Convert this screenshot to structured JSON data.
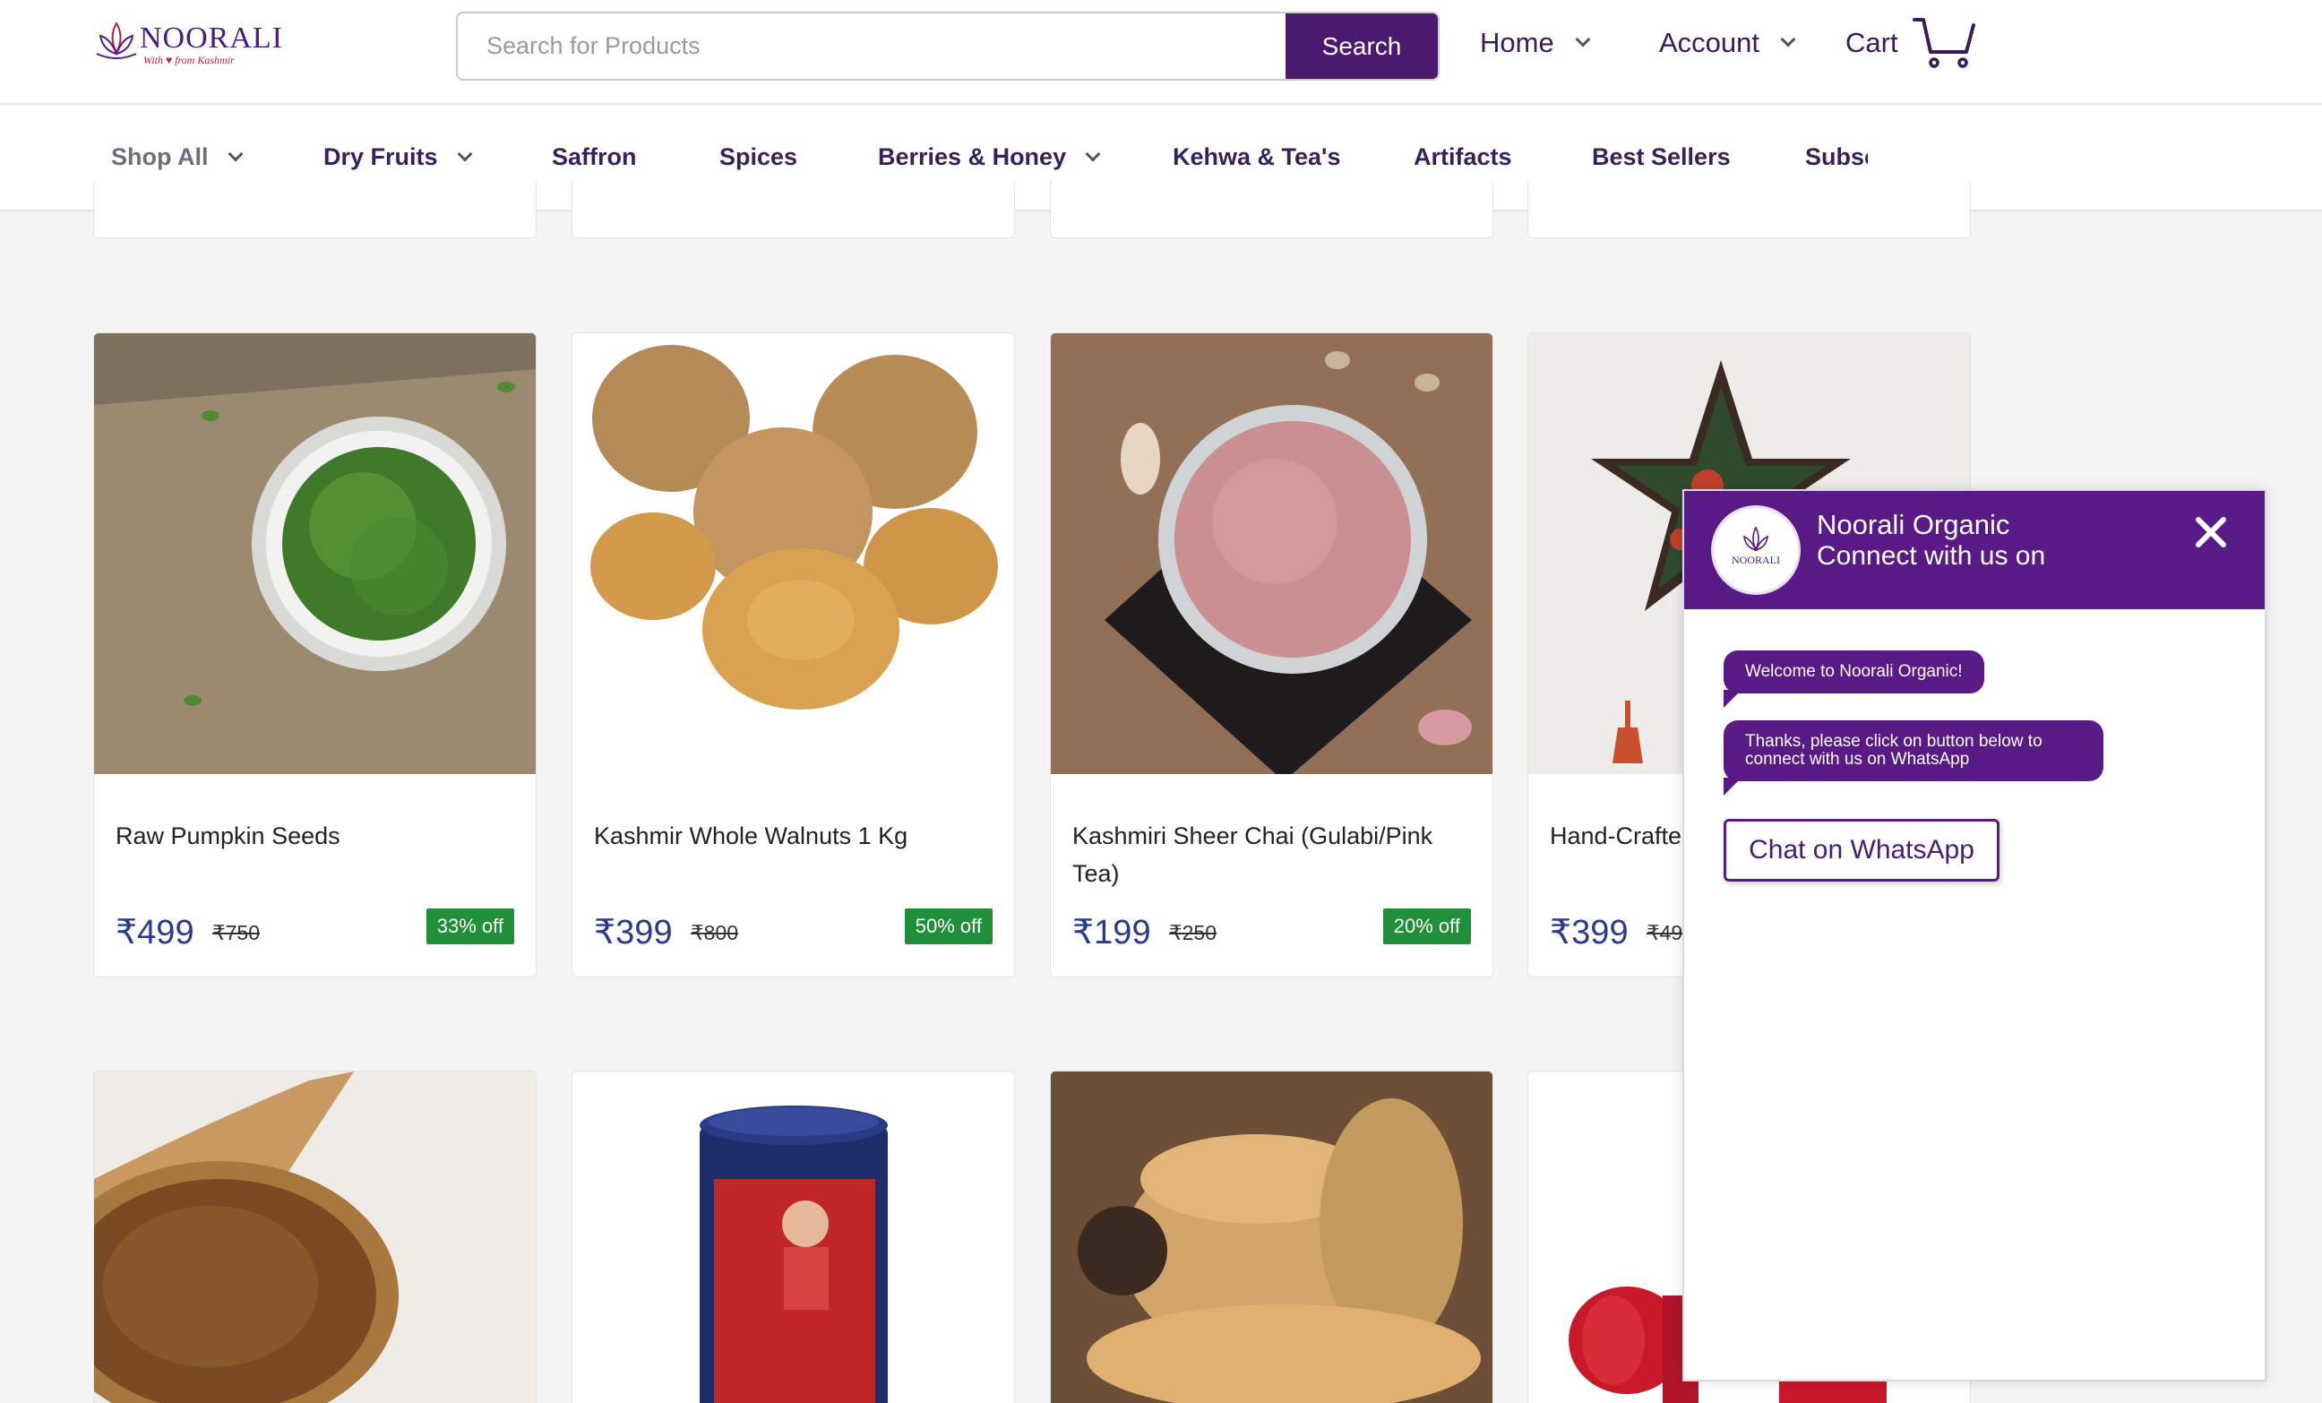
{
  "header": {
    "logo_text": "NOORALI",
    "logo_tagline": "With ♥ from Kashmir",
    "search_placeholder": "Search for Products",
    "search_button": "Search",
    "nav": [
      {
        "label": "Home",
        "has_dropdown": true
      },
      {
        "label": "Account",
        "has_dropdown": true
      }
    ],
    "cart_label": "Cart"
  },
  "categories": [
    {
      "label": "Shop All",
      "has_dropdown": true
    },
    {
      "label": "Dry Fruits",
      "has_dropdown": true
    },
    {
      "label": "Saffron",
      "has_dropdown": false
    },
    {
      "label": "Spices",
      "has_dropdown": false
    },
    {
      "label": "Berries & Honey",
      "has_dropdown": true
    },
    {
      "label": "Kehwa & Tea's",
      "has_dropdown": false
    },
    {
      "label": "Artifacts",
      "has_dropdown": false
    },
    {
      "label": "Best Sellers",
      "has_dropdown": false
    },
    {
      "label": "Subsc",
      "has_dropdown": false
    }
  ],
  "products_row1": [
    {
      "name": "Raw Pumpkin Seeds",
      "price": "₹499",
      "mrp": "₹750",
      "discount": "33% off"
    },
    {
      "name": "Kashmir Whole Walnuts 1 Kg",
      "price": "₹399",
      "mrp": "₹800",
      "discount": "50% off"
    },
    {
      "name": "Kashmiri Sheer Chai (Gulabi/Pink Tea)",
      "price": "₹199",
      "mrp": "₹250",
      "discount": "20% off"
    },
    {
      "name": "Hand-Crafte",
      "price": "₹399",
      "mrp": "₹49",
      "discount": ""
    }
  ],
  "chat": {
    "avatar_text": "NOORALI",
    "title": "Noorali Organic",
    "subtitle": "Connect with us on",
    "messages": [
      "Welcome to Noorali Organic!",
      "Thanks, please click on button below to connect with us on WhatsApp"
    ],
    "button": "Chat on WhatsApp"
  },
  "colors": {
    "brand_purple": "#4b1a6f",
    "chat_purple": "#5a1a86",
    "price_blue": "#2a3a8c",
    "discount_green": "#1f8f3a"
  },
  "icons": [
    "cart-icon",
    "chevron-down-icon",
    "close-icon",
    "lotus-logo-icon"
  ]
}
